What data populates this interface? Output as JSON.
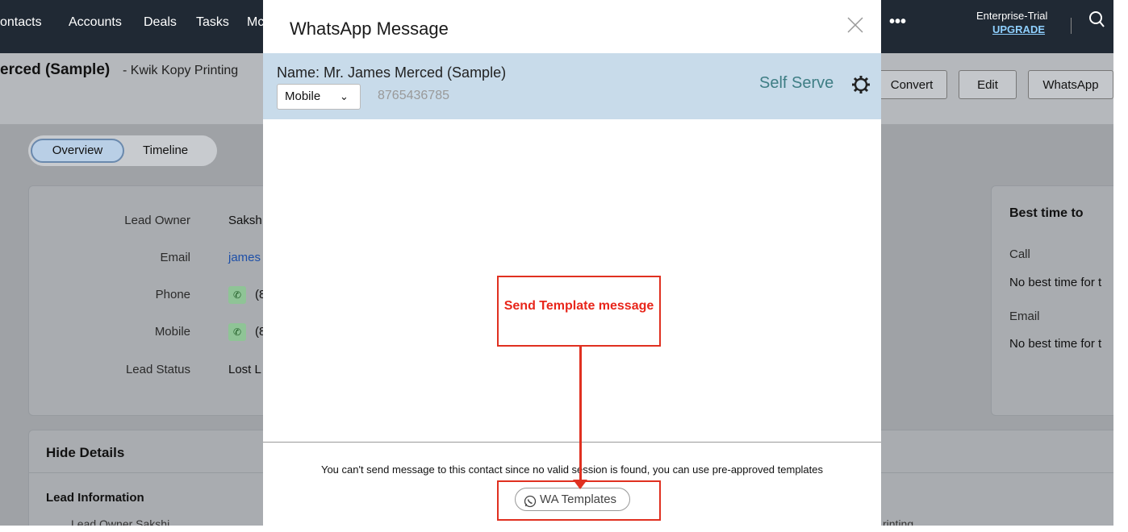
{
  "topnav": {
    "items": [
      "ontacts",
      "Accounts",
      "Deals",
      "Tasks",
      "Mc"
    ],
    "more": "•••",
    "plan": "Enterprise-Trial",
    "upgrade": "UPGRADE"
  },
  "header": {
    "title": "erced (Sample)",
    "subtitle": "- Kwik Kopy Printing",
    "buttons": [
      "Convert",
      "Edit",
      "WhatsApp"
    ]
  },
  "tabs": [
    "Overview",
    "Timeline"
  ],
  "details": {
    "rows": [
      {
        "label": "Lead Owner",
        "value": "Saksh"
      },
      {
        "label": "Email",
        "value": "james"
      },
      {
        "label": "Phone",
        "value": "(8"
      },
      {
        "label": "Mobile",
        "value": "(8"
      },
      {
        "label": "Lead Status",
        "value": "Lost L"
      }
    ]
  },
  "side": {
    "title": "Best time to",
    "call_label": "Call",
    "call_value": "No best time for t",
    "email_label": "Email",
    "email_value": "No best time for t"
  },
  "hide_details": "Hide Details",
  "lead_information": "Lead Information",
  "bottom": {
    "left": "Lead Owner     Sakshi",
    "right": "rinting"
  },
  "modal": {
    "title": "WhatsApp Message",
    "contact_name": "Name: Mr. James Merced (Sample)",
    "phone_type": "Mobile",
    "phone_number": "8765436785",
    "self_serve": "Self Serve",
    "notice": "You can't send message to this contact since no valid session is found, you can use pre-approved templates",
    "templates_button": "WA Templates"
  },
  "annotation": {
    "text": "Send Template message",
    "color": "#e03020"
  },
  "colors": {
    "nav_bg": "#202934",
    "contact_bar": "#c8dbea",
    "self_serve": "#3f7e85"
  }
}
